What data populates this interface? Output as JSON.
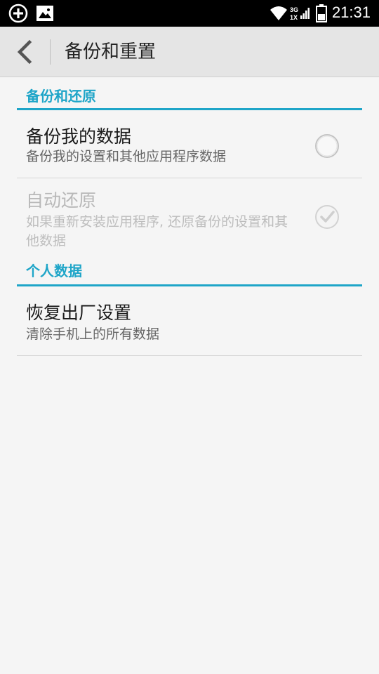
{
  "status_bar": {
    "time": "21:31",
    "net_top": "3G",
    "net_bottom": "1X",
    "icons": [
      "add-circle-icon",
      "image-icon",
      "wifi-icon",
      "signal-icon",
      "battery-icon"
    ]
  },
  "action_bar": {
    "title": "备份和重置",
    "back_icon": "back-arrow-icon"
  },
  "sections": [
    {
      "header": "备份和还原",
      "items": [
        {
          "title": "备份我的数据",
          "summary": "备份我的设置和其他应用程序数据",
          "checked": false,
          "enabled": true
        },
        {
          "title": "自动还原",
          "summary": "如果重新安装应用程序, 还原备份的设置和其他数据",
          "checked": true,
          "enabled": false
        }
      ]
    },
    {
      "header": "个人数据",
      "items": [
        {
          "title": "恢复出厂设置",
          "summary": "清除手机上的所有数据"
        }
      ]
    }
  ],
  "colors": {
    "accent": "#1ea5c8",
    "background": "#f5f5f5",
    "action_bar": "#e5e5e5"
  }
}
